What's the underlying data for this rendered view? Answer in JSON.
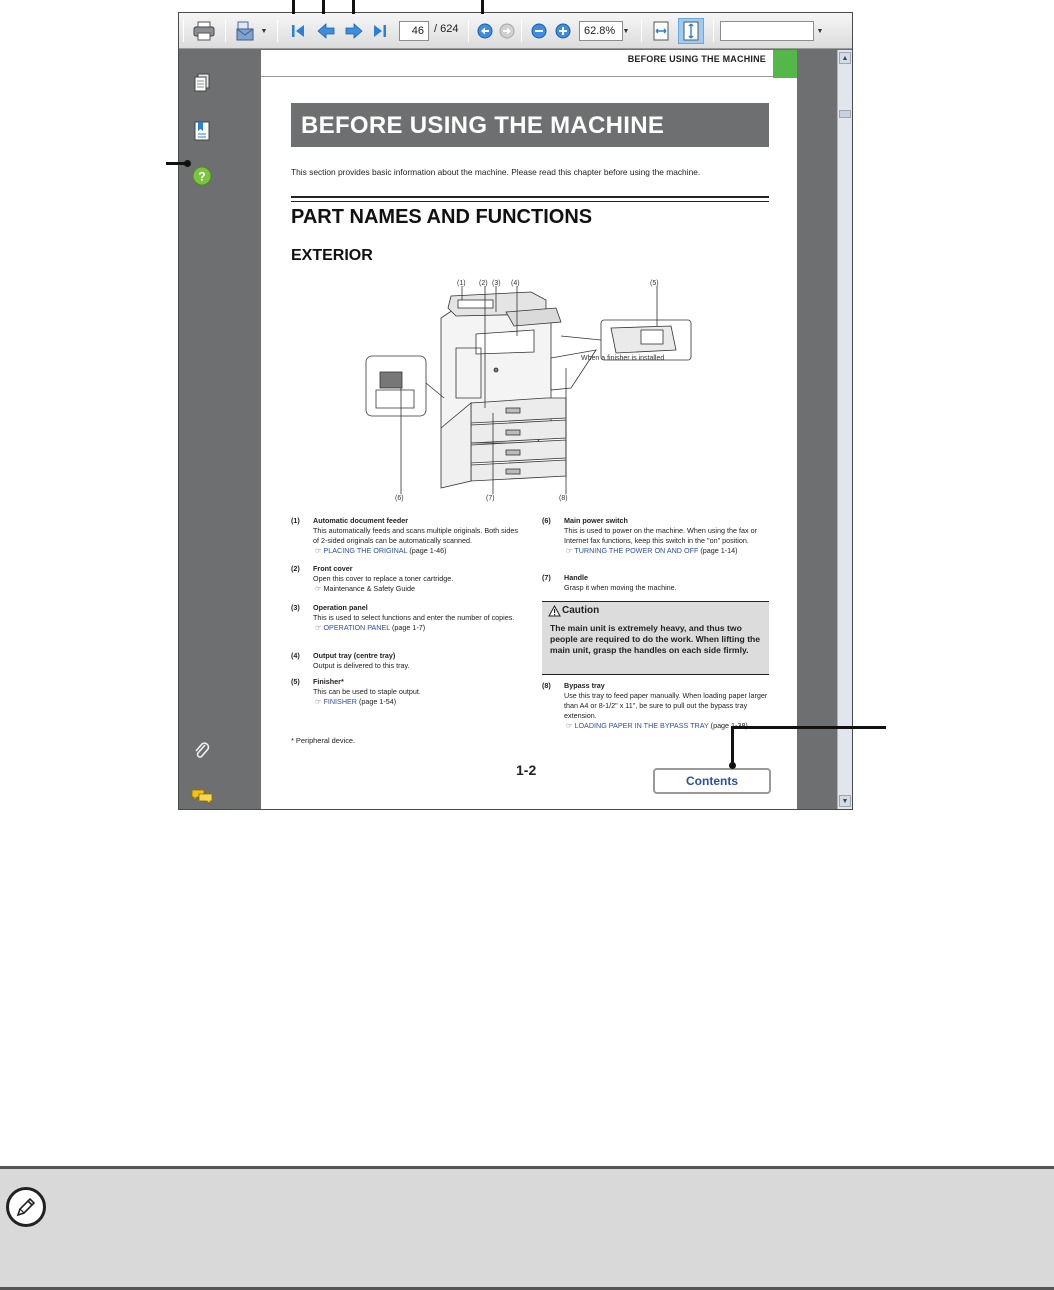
{
  "toolbar": {
    "page_current": "46",
    "page_total": "/ 624",
    "zoom": "62.8%",
    "find_placeholder": ""
  },
  "page": {
    "running_head": "BEFORE USING THE MACHINE",
    "chapter_title": "BEFORE USING THE MACHINE",
    "intro": "This section provides basic information about the machine. Please read this chapter before using the machine.",
    "heading": "PART NAMES AND FUNCTIONS",
    "subheading": "EXTERIOR",
    "figure_callouts": [
      "(1)",
      "(2)",
      "(3)",
      "(4)",
      "(5)",
      "(6)",
      "(7)",
      "(8)"
    ],
    "finisher_caption": "When a finisher is installed",
    "items_left": [
      {
        "num": "(1)",
        "title": "Automatic document feeder",
        "text": "This automatically feeds and scans multiple originals. Both sides of 2-sided originals can be automatically scanned.",
        "link": "PLACING THE ORIGINAL",
        "ref": "(page 1-46)"
      },
      {
        "num": "(2)",
        "title": "Front cover",
        "text": "Open this cover to replace a toner cartridge.",
        "link": "",
        "ref": "Maintenance & Safety Guide"
      },
      {
        "num": "(3)",
        "title": "Operation panel",
        "text": "This is used to select functions and enter the number of copies.",
        "link": "OPERATION PANEL",
        "ref": "(page 1-7)"
      },
      {
        "num": "(4)",
        "title": "Output tray (centre tray)",
        "text": "Output is delivered to this tray.",
        "link": "",
        "ref": ""
      },
      {
        "num": "(5)",
        "title": "Finisher*",
        "text": "This can be used to staple output.",
        "link": "FINISHER",
        "ref": "(page 1-54)"
      }
    ],
    "items_right": [
      {
        "num": "(6)",
        "title": "Main power switch",
        "text": "This is used to power on the machine. When using the fax or Internet fax functions, keep this switch in the \"on\" position.",
        "link": "TURNING THE POWER ON AND OFF",
        "ref": "(page 1-14)"
      },
      {
        "num": "(7)",
        "title": "Handle",
        "text": "Grasp it when moving the machine.",
        "link": "",
        "ref": ""
      },
      {
        "num": "(8)",
        "title": "Bypass tray",
        "text": "Use this tray to feed paper manually. When loading paper larger than A4 or 8-1/2\" x 11\", be sure to pull out the bypass tray extension.",
        "link": "LOADING PAPER IN THE BYPASS TRAY",
        "ref": "(page 1-38)"
      }
    ],
    "caution_title": "Caution",
    "caution_body": "The main unit is extremely heavy, and thus two people are required to do the work. When lifting the main unit, grasp the handles on each side firmly.",
    "footnote": "*  Peripheral device.",
    "page_number": "1-2",
    "contents_button": "Contents"
  },
  "colors": {
    "gray_band": "#6d6f71",
    "green_tab": "#54b848",
    "link_blue": "#2d4fa3",
    "note_bg": "#d9d9d9"
  },
  "icons": [
    "print-icon",
    "email-icon",
    "first-page-icon",
    "previous-page-icon",
    "next-page-icon",
    "last-page-icon",
    "previous-view-icon",
    "next-view-icon",
    "zoom-out-icon",
    "zoom-in-icon",
    "fit-width-icon",
    "fit-page-icon",
    "pages-icon",
    "bookmarks-icon",
    "help-icon",
    "attachment-icon",
    "comments-icon",
    "pencil-icon",
    "warning-icon"
  ]
}
